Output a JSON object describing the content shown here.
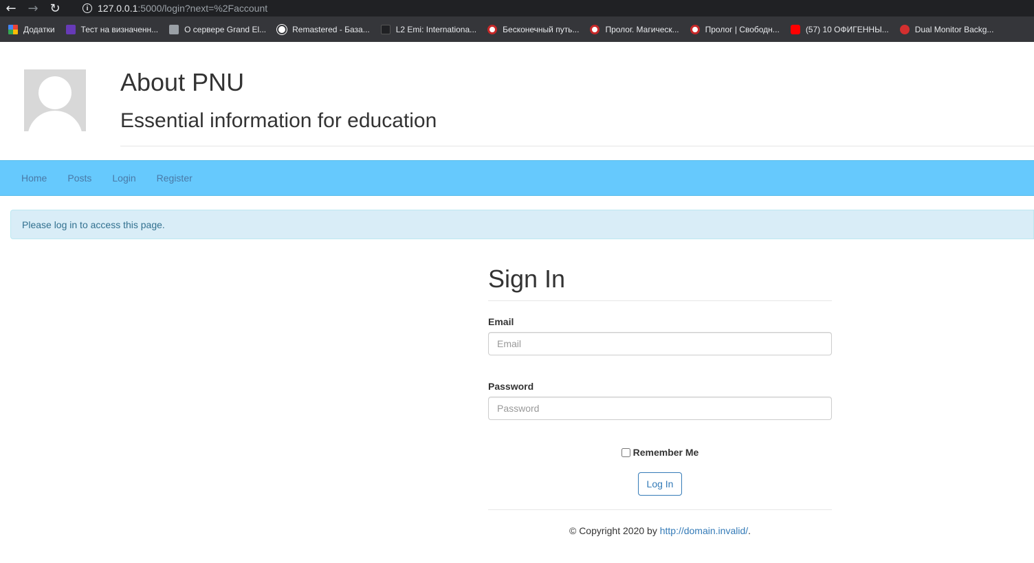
{
  "browser": {
    "url_host": "127.0.0.1",
    "url_rest": ":5000/login?next=%2Faccount",
    "back_icon": "arrow-left-icon",
    "forward_icon": "arrow-right-icon",
    "reload_icon": "reload-icon",
    "bookmarks": [
      {
        "label": "Додатки",
        "icon": "apps-icon"
      },
      {
        "label": "Тест на визначенн...",
        "icon": "form-icon"
      },
      {
        "label": "О сервере Grand El...",
        "icon": "site-icon"
      },
      {
        "label": "Remastered - База...",
        "icon": "globe-icon"
      },
      {
        "label": "L2 Emi: Internationa...",
        "icon": "site-icon"
      },
      {
        "label": "Бесконечный путь...",
        "icon": "site-icon"
      },
      {
        "label": "Пролог. Магическ...",
        "icon": "site-icon"
      },
      {
        "label": "Пролог | Свободн...",
        "icon": "site-icon"
      },
      {
        "label": "(57) 10 ОФИГЕННЫ...",
        "icon": "youtube-icon"
      },
      {
        "label": "Dual Monitor Backg...",
        "icon": "site-icon"
      }
    ]
  },
  "header": {
    "title": "About PNU",
    "subtitle": "Essential information for education"
  },
  "nav": {
    "items": [
      "Home",
      "Posts",
      "Login",
      "Register"
    ]
  },
  "alert": {
    "message": "Please log in to access this page."
  },
  "form": {
    "title": "Sign In",
    "email_label": "Email",
    "email_placeholder": "Email",
    "email_value": "",
    "password_label": "Password",
    "password_placeholder": "Password",
    "password_value": "",
    "remember_label": "Remember Me",
    "submit_label": "Log In"
  },
  "footer": {
    "text": "© Copyright 2020 by ",
    "link": "http://domain.invalid/",
    "suffix": "."
  },
  "colors": {
    "navbar": "#66c9fd",
    "alert_bg": "#d9edf7",
    "link": "#337ab7"
  }
}
